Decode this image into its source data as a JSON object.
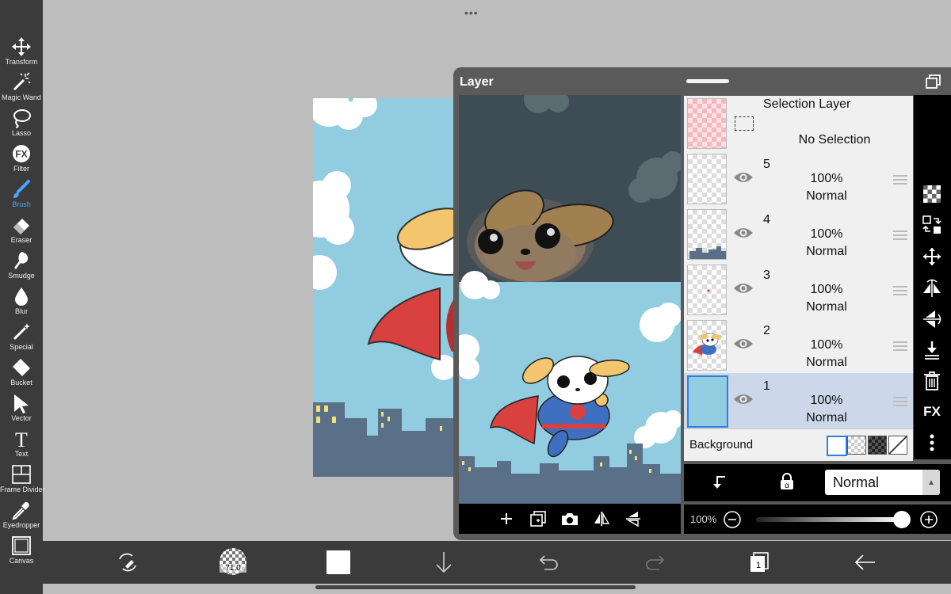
{
  "toolbar": {
    "tools": [
      {
        "label": "Transform",
        "icon": "move-arrows-icon"
      },
      {
        "label": "Magic Wand",
        "icon": "magic-wand-icon"
      },
      {
        "label": "Lasso",
        "icon": "lasso-icon"
      },
      {
        "label": "Filter",
        "icon": "fx-icon"
      },
      {
        "label": "Brush",
        "icon": "brush-icon",
        "active": true
      },
      {
        "label": "Eraser",
        "icon": "eraser-icon"
      },
      {
        "label": "Smudge",
        "icon": "smudge-icon"
      },
      {
        "label": "Blur",
        "icon": "drop-icon"
      },
      {
        "label": "Special",
        "icon": "sparkle-wand-icon"
      },
      {
        "label": "Bucket",
        "icon": "bucket-icon"
      },
      {
        "label": "Vector",
        "icon": "cursor-arrow-icon"
      },
      {
        "label": "Text",
        "icon": "text-t-icon"
      },
      {
        "label": "Frame Divider",
        "icon": "frame-divider-icon"
      },
      {
        "label": "Eyedropper",
        "icon": "eyedropper-icon"
      },
      {
        "label": "Canvas",
        "icon": "canvas-icon"
      }
    ]
  },
  "layer_panel": {
    "title": "Layer",
    "selection_layer": {
      "title": "Selection Layer",
      "status": "No Selection"
    },
    "layers": [
      {
        "number": "5",
        "opacity": "100%",
        "mode": "Normal",
        "selected": false
      },
      {
        "number": "4",
        "opacity": "100%",
        "mode": "Normal",
        "selected": false
      },
      {
        "number": "3",
        "opacity": "100%",
        "mode": "Normal",
        "selected": false
      },
      {
        "number": "2",
        "opacity": "100%",
        "mode": "Normal",
        "selected": false
      },
      {
        "number": "1",
        "opacity": "100%",
        "mode": "Normal",
        "selected": true
      }
    ],
    "background_label": "Background",
    "blend_mode": "Normal",
    "opacity_label": "100%",
    "opacity_value": 1.0,
    "right_icons": [
      "checker-icon",
      "swap-icon",
      "move-icon",
      "flip-horizontal-icon",
      "flip-vertical-icon",
      "merge-down-icon",
      "trash-icon",
      "fx-text-icon",
      "more-vertical-icon"
    ],
    "right_fx_label": "FX",
    "preview_toolbar_icons": [
      "add-layer-icon",
      "copy-layer-icon",
      "camera-icon",
      "flip-h-icon",
      "flip-v-icon"
    ]
  },
  "bottom_bar": {
    "brush_size": "71.0",
    "page_count": "1"
  },
  "colors": {
    "sky": "#91cce0",
    "cloud": "#ffffff",
    "building": "#5a7088",
    "window": "#f2e070",
    "cape": "#d94040",
    "suit": "#3f6fc0",
    "panel_bg": "#5a5a5a",
    "accent": "#4aa3ff"
  }
}
